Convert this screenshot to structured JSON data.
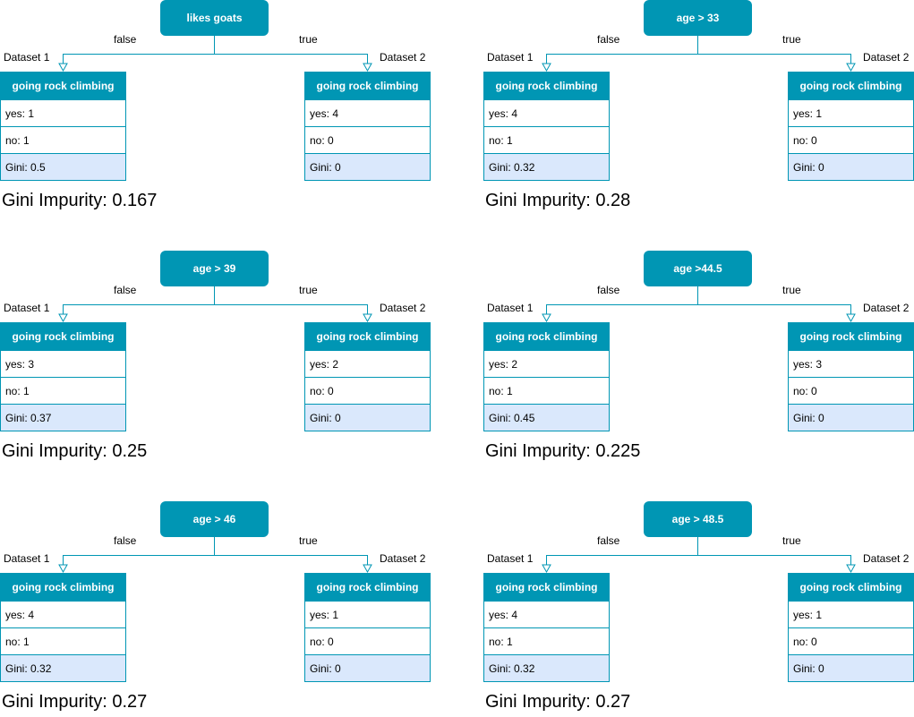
{
  "labels": {
    "false": "false",
    "true": "true",
    "left_dataset": "Dataset 1",
    "right_dataset": "Dataset 2",
    "table_header": "going rock climbing"
  },
  "colors": {
    "accent": "#0096b4",
    "gini_row": "#dae8fc"
  },
  "panels": [
    {
      "split": "likes goats",
      "left": {
        "yes": "yes: 1",
        "no": "no: 1",
        "gini": "Gini: 0.5"
      },
      "right": {
        "yes": "yes: 4",
        "no": "no: 0",
        "gini": "Gini: 0"
      },
      "impurity": "Gini Impurity: 0.167"
    },
    {
      "split": "age > 33",
      "left": {
        "yes": "yes: 4",
        "no": "no: 1",
        "gini": "Gini: 0.32"
      },
      "right": {
        "yes": "yes: 1",
        "no": "no: 0",
        "gini": "Gini: 0"
      },
      "impurity": "Gini Impurity: 0.28"
    },
    {
      "split": "age > 39",
      "left": {
        "yes": "yes: 3",
        "no": "no: 1",
        "gini": "Gini: 0.37"
      },
      "right": {
        "yes": "yes: 2",
        "no": "no: 0",
        "gini": "Gini: 0"
      },
      "impurity": "Gini Impurity: 0.25"
    },
    {
      "split": "age >44.5",
      "left": {
        "yes": "yes: 2",
        "no": "no: 1",
        "gini": "Gini: 0.45"
      },
      "right": {
        "yes": "yes: 3",
        "no": "no: 0",
        "gini": "Gini: 0"
      },
      "impurity": "Gini Impurity: 0.225"
    },
    {
      "split": "age > 46",
      "left": {
        "yes": "yes: 4",
        "no": "no: 1",
        "gini": "Gini: 0.32"
      },
      "right": {
        "yes": "yes: 1",
        "no": "no: 0",
        "gini": "Gini: 0"
      },
      "impurity": "Gini Impurity: 0.27"
    },
    {
      "split": "age > 48.5",
      "left": {
        "yes": "yes: 4",
        "no": "no: 1",
        "gini": "Gini: 0.32"
      },
      "right": {
        "yes": "yes: 1",
        "no": "no: 0",
        "gini": "Gini: 0"
      },
      "impurity": "Gini Impurity: 0.27"
    }
  ]
}
